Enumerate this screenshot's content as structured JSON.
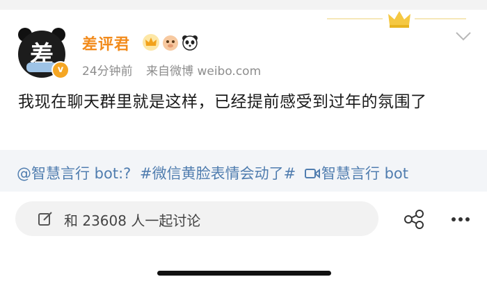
{
  "post": {
    "author": "差评君",
    "avatar_text": "差",
    "verified_badge": "v",
    "time": "24分钟前",
    "source": "来自微博 weibo.com",
    "text": "我现在聊天群里就是这样，已经提前感受到过年的氛围了"
  },
  "tags": {
    "tag1": "@智慧言行 bot:?",
    "tag2": "#微信黄脸表情会动了#",
    "tag3": "智慧言行 bot"
  },
  "actions": {
    "comment_placeholder": "和 23608 人一起讨论"
  },
  "colors": {
    "author": "#f28b1c",
    "link": "#507daf",
    "meta": "#8d8d8d"
  },
  "icons": {
    "crown": "crown-icon",
    "chevron": "chevron-down-icon",
    "edit": "edit-icon",
    "share": "share-icon",
    "more": "more-icon",
    "video": "video-icon"
  }
}
